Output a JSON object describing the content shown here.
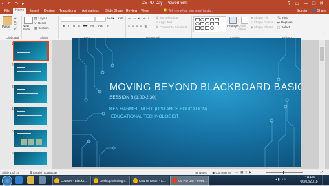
{
  "window": {
    "title": "CE PD Day - PowerPoint",
    "controls": [
      "?",
      "▭",
      "—",
      "□",
      "✕"
    ]
  },
  "tabs": [
    "File",
    "Home",
    "Insert",
    "Design",
    "Transitions",
    "Animations",
    "Slide Show",
    "Review",
    "View"
  ],
  "active_tab": "Home",
  "tell_me": "Tell me what you want to do...",
  "sign_in": "Sign in",
  "share": "Share",
  "ribbon": {
    "clipboard": {
      "label": "Clipboard",
      "paste": "Paste"
    },
    "slides": {
      "label": "Slides",
      "new_slide": "New Slide",
      "layout": "Layout",
      "reset": "Reset",
      "section": "Section"
    },
    "font": {
      "label": "Font",
      "bold": "B",
      "italic": "I",
      "underline": "U",
      "strike": "S",
      "shadow": "abc",
      "spacing": "AV",
      "case": "Aa",
      "color": "A"
    },
    "paragraph": {
      "label": "Paragraph",
      "text_direction": "Text Direction",
      "align_text": "Align Text",
      "smartart": "Convert to SmartArt"
    },
    "drawing": {
      "label": "Drawing",
      "arrange": "Arrange",
      "quick_styles": "Quick Styles",
      "shape_fill": "Shape Fill",
      "shape_outline": "Shape Outline",
      "shape_effects": "Shape Effects"
    },
    "editing": {
      "label": "Editing",
      "find": "Find",
      "replace": "Replace",
      "select": "Select"
    }
  },
  "thumbnails": [
    {
      "num": "1"
    },
    {
      "num": "2"
    },
    {
      "num": "3"
    },
    {
      "num": "4"
    },
    {
      "num": "5"
    },
    {
      "num": "6"
    }
  ],
  "slide": {
    "title": "MOVING BEYOND BLACKBOARD BASICS",
    "subtitle": "SESSION 3 (1:00-2:30)",
    "author": "KEN HARMEL, M.ED. (DISTANCE EDUCATION)",
    "role": "EDUCATIONAL TECHNOLOGIST"
  },
  "status": {
    "slide_info": "Slide 1 of 16",
    "language": "English (Canada)",
    "notes": "Notes",
    "comments": "Comments",
    "zoom_minus": "−",
    "zoom_plus": "+"
  },
  "taskbar": {
    "start": "start",
    "items": [
      {
        "label": "Courses - Blackb...",
        "color": "#f4b400"
      },
      {
        "label": "Desktop Sharing I...",
        "color": "#f4b400"
      },
      {
        "label": "Course Room - C...",
        "color": "#f4b400"
      },
      {
        "label": "CE PD Day - Powe...",
        "color": "#d24726"
      }
    ],
    "time": "1:04 PM",
    "date": "06/02/2018"
  },
  "colors": {
    "accent": "#b7472a",
    "slide_bg": "#1672a3",
    "slide_text": "#6fe0ff"
  }
}
